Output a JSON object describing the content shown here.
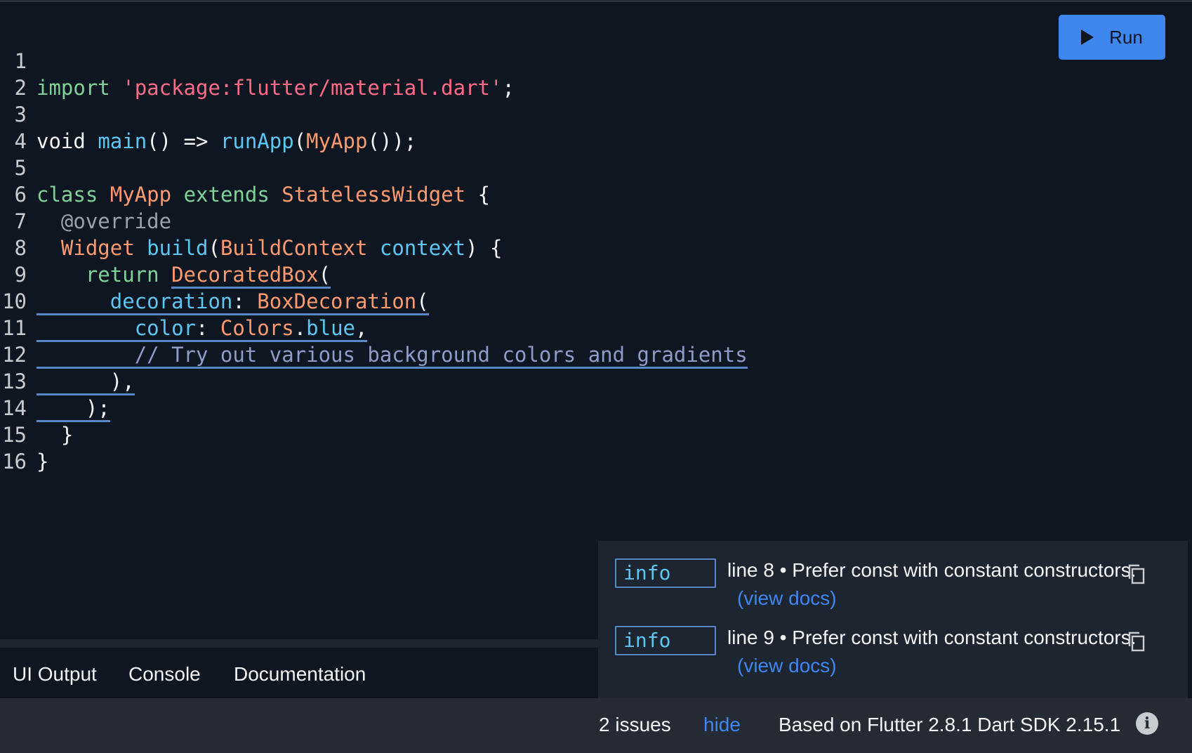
{
  "editor": {
    "lines": [
      "1",
      "2",
      "3",
      "4",
      "5",
      "6",
      "7",
      "8",
      "9",
      "10",
      "11",
      "12",
      "13",
      "14",
      "15",
      "16"
    ],
    "code": {
      "l1_import": "import",
      "l1_str": "'package:flutter/material.dart'",
      "l1_semi": ";",
      "l3_void": "void ",
      "l3_main": "main",
      "l3_mid": "() => ",
      "l3_runApp": "runApp",
      "l3_paren": "(",
      "l3_myapp": "MyApp",
      "l3_end": "());",
      "l5_class": "class",
      "l5_myapp": "MyApp",
      "l5_extends": "extends",
      "l5_stateless": "StatelessWidget",
      "l5_brace": "{",
      "l6_override": "@override",
      "l7_widget": "Widget",
      "l7_build": "build",
      "l7_open": "(",
      "l7_buildcontext": "BuildContext",
      "l7_context": "context",
      "l7_close": ") {",
      "l8_return": "return",
      "l8_decoratedbox": "DecoratedBox",
      "l8_paren": "(",
      "l9_decoration": "decoration",
      "l9_colon": ": ",
      "l9_boxdecoration": "BoxDecoration",
      "l9_paren": "(",
      "l10_color": "color",
      "l10_colon": ": ",
      "l10_colors": "Colors",
      "l10_dot": ".",
      "l10_blue": "blue",
      "l10_comma": ",",
      "l11_comment": "// Try out various background colors and gradients",
      "l12": "),",
      "l13": ");",
      "l14": "}",
      "l15": "}"
    }
  },
  "toolbar": {
    "run_label": "Run"
  },
  "issues": [
    {
      "badge": "info",
      "message": "line 8 • Prefer const with constant constructors.",
      "link": "(view docs)"
    },
    {
      "badge": "info",
      "message": "line 9 • Prefer const with constant constructors.",
      "link": "(view docs)"
    }
  ],
  "tabs": [
    "UI Output",
    "Console",
    "Documentation"
  ],
  "status": {
    "issue_count": "2 issues",
    "hide_label": "hide",
    "version": "Based on Flutter 2.8.1 Dart SDK 2.15.1"
  },
  "colors": {
    "background": "#0e1621",
    "accent": "#3f86ef",
    "panel": "#1d2530",
    "status_bar": "#242b35"
  },
  "icons": [
    "play-icon",
    "copy-icon",
    "info-icon"
  ]
}
